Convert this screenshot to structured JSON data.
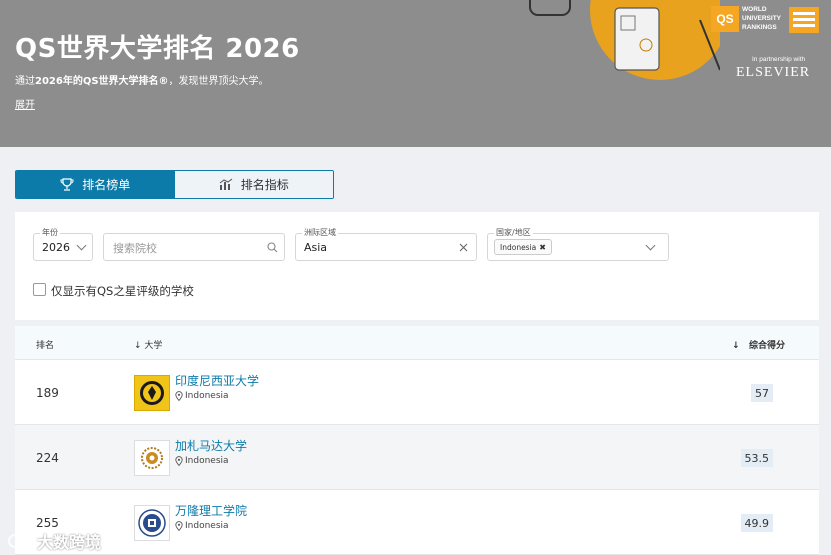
{
  "hero": {
    "title": "QS世界大学排名 2026",
    "subtitle_prefix": "通过",
    "subtitle_bold": "2026年的QS世界大学排名®",
    "subtitle_suffix": "，发现世界顶尖大学。",
    "expand_label": "展开",
    "logo_qs": "QS",
    "logo_line1": "WORLD",
    "logo_line2": "UNIVERSITY",
    "logo_line3": "RANKINGS",
    "partner_text": "In partnership with",
    "partner_name": "ELSEVIER"
  },
  "tabs": [
    {
      "label": "排名榜单",
      "active": true
    },
    {
      "label": "排名指标",
      "active": false
    }
  ],
  "filters": {
    "year_label": "年份",
    "year_value": "2026",
    "search_placeholder": "搜索院校",
    "region_label": "洲际区域",
    "region_value": "Asia",
    "country_label": "国家/地区",
    "country_chip": "Indonesia",
    "star_only_label": "仅显示有QS之星评级的学校"
  },
  "table": {
    "col_rank": "排名",
    "col_university": "大学",
    "col_score": "综合得分",
    "rows": [
      {
        "rank": "189",
        "name": "印度尼西亚大学",
        "location": "Indonesia",
        "score": "57"
      },
      {
        "rank": "224",
        "name": "加札马达大学",
        "location": "Indonesia",
        "score": "53.5"
      },
      {
        "rank": "255",
        "name": "万隆理工学院",
        "location": "Indonesia",
        "score": "49.9"
      }
    ]
  },
  "watermark": "大数跨境",
  "colors": {
    "accent": "#0c7ba9",
    "hero_bg": "#8d8d8d",
    "qs_orange": "#f5a623"
  }
}
